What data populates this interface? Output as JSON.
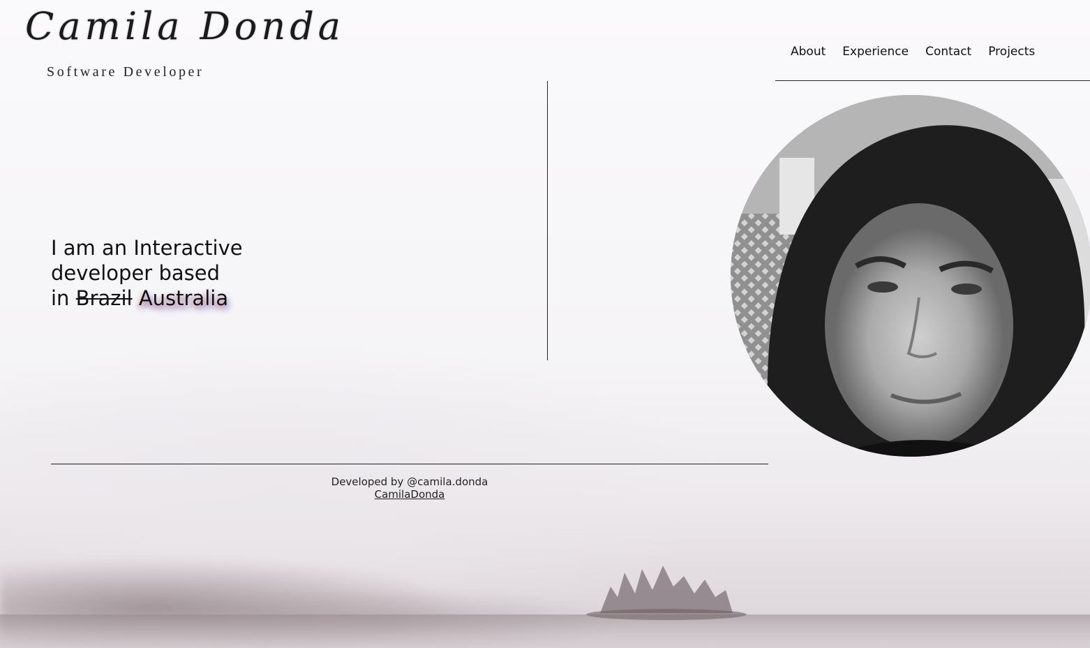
{
  "header": {
    "logo_text": "Camila Donda",
    "role": "Software Developer"
  },
  "nav": {
    "items": [
      {
        "label": "About"
      },
      {
        "label": "Experience"
      },
      {
        "label": "Contact"
      },
      {
        "label": "Projects"
      }
    ]
  },
  "intro": {
    "line1": "I am an Interactive",
    "line2": "developer based",
    "line3_prefix": "in",
    "old_location": "Brazil",
    "new_location": "Australia"
  },
  "footer": {
    "credit": "Developed by @camila.donda",
    "link_label": "CamilaDonda"
  }
}
